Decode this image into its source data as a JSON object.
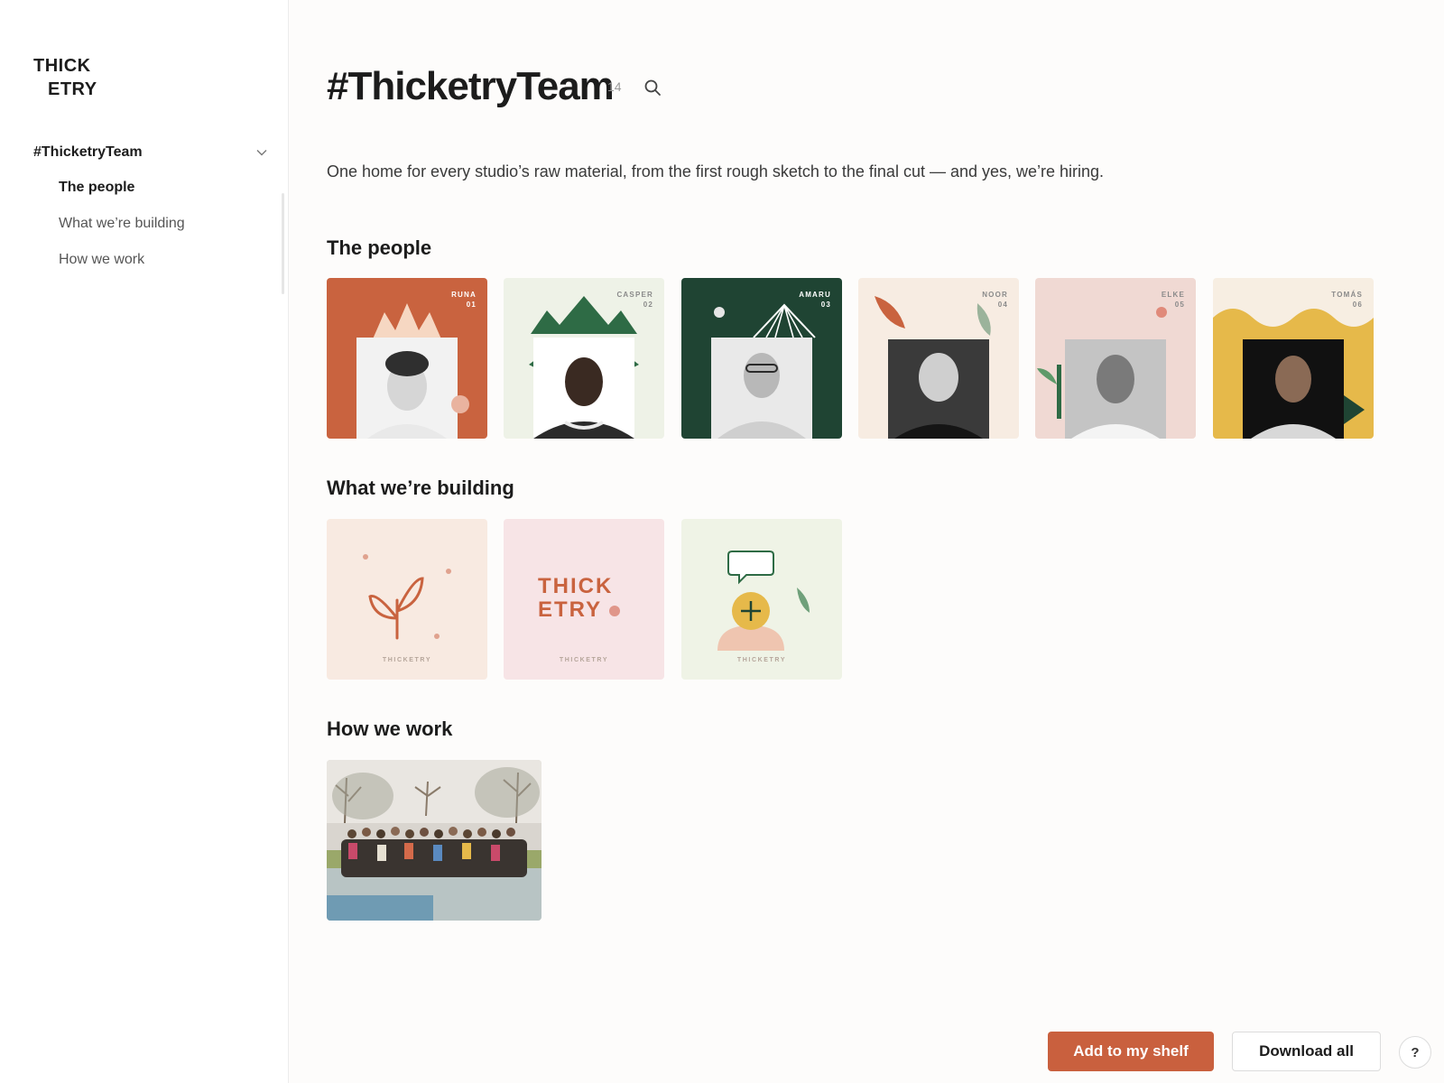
{
  "brand": {
    "line1": "THICK",
    "line2": "ETRY"
  },
  "sidebar": {
    "group_label": "#ThicketryTeam",
    "items": [
      {
        "label": "The people",
        "active": true
      },
      {
        "label": "What we’re building",
        "active": false
      },
      {
        "label": "How we work",
        "active": false
      }
    ]
  },
  "header": {
    "title": "#ThicketryTeam",
    "count": "14",
    "intro": "One home for every studio’s raw material, from the first rough sketch to the final cut — and yes, we’re hiring."
  },
  "sections": {
    "people": {
      "title": "The people",
      "cards": [
        {
          "name": "RUNA",
          "num": "01",
          "bg": "#c9633f"
        },
        {
          "name": "CASPER",
          "num": "02",
          "bg": "#eef2e7"
        },
        {
          "name": "AMARU",
          "num": "03",
          "bg": "#1f4433"
        },
        {
          "name": "NOOR",
          "num": "04",
          "bg": "#f7ece2"
        },
        {
          "name": "ELKE",
          "num": "05",
          "bg": "#f0d9d3"
        },
        {
          "name": "TOMÁS",
          "num": "06",
          "bg": "#f7eee2"
        }
      ]
    },
    "building": {
      "title": "What we’re building",
      "cards": [
        {
          "watermark": "THICKETRY",
          "bg": "#f8eae1"
        },
        {
          "watermark": "THICKETRY",
          "bg": "#f7e4e6",
          "logo_line1": "THICK",
          "logo_line2": "ETRY"
        },
        {
          "watermark": "THICKETRY",
          "bg": "#eff3e6"
        }
      ]
    },
    "work": {
      "title": "How we work"
    }
  },
  "actions": {
    "add_label": "Add to my shelf",
    "download_label": "Download all",
    "help_label": "?"
  },
  "colors": {
    "accent": "#c9603e",
    "dark_green": "#1f4433",
    "yellow": "#e6b94a"
  }
}
